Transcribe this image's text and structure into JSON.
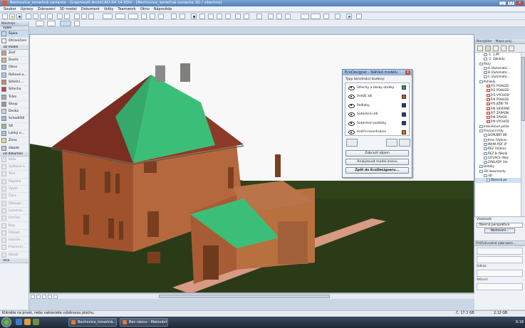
{
  "window": {
    "title": "Bechovice_konečná varianta - Graphisoft ArchiCAD-64 14 EDU - [Bechovice_konečná varianta 3D / všechno]",
    "buttons": [
      "_",
      "□",
      "×"
    ]
  },
  "menu": [
    "Soubor",
    "Úpravy",
    "Zobrazení",
    "3D model",
    "Dokument",
    "Volby",
    "Teamwork",
    "Okno",
    "Nápověda"
  ],
  "toolbox": {
    "title": "Nástroje...",
    "select_section": "Výběr",
    "select_items": [
      "Šipka",
      "Ohraničení"
    ],
    "section_3d": "3D model",
    "items_3d": [
      "Zeď",
      "Dveře",
      "Okno",
      "Rohové o...",
      "Střešní ...",
      "Střecha",
      "Trám",
      "Sloup",
      "Deska",
      "Schodiště",
      "Síť",
      "Lehký o...",
      "Zóna",
      "Objekt"
    ],
    "section_2d": "2D dokumen",
    "items_2d": [
      "Kóta",
      "Výšková k...",
      "Text",
      "Popiska",
      "Výplň",
      "Čára",
      "Oblouk/...",
      "Lomená...",
      "Hrnčka",
      "Bay",
      "Pohled",
      "Interiér...",
      "Pracovní...",
      "Detail"
    ],
    "more": "Více"
  },
  "ecodesigner": {
    "title": "EcoDesigner - Náhled modelu",
    "subtitle": "Typy konstrukcí budovy:",
    "rows": [
      {
        "label": "Střechy a desky otvěky",
        "color": "#27a05a"
      },
      {
        "label": "Vnější zdi",
        "color": "#c05a2a"
      },
      {
        "label": "Podlahy",
        "color": "#1e3a8a"
      },
      {
        "label": "Suterénní zdi",
        "color": "#1e3a8a"
      },
      {
        "label": "Suterénní podlahy",
        "color": "#1e3a8a"
      },
      {
        "label": "Vnitřní konstrukce",
        "color": "#e0701e"
      }
    ],
    "btn_show": "Zobrazit objem",
    "btn_analyze": "Analyzovat model znovu",
    "btn_back": "Zpět do EcoDesigneru..."
  },
  "navigator": {
    "title": "Navigátor - Mapa proj...",
    "items": [
      {
        "label": "-1. 1.PP",
        "red": false
      },
      {
        "label": "-2. Základy",
        "red": false
      },
      {
        "label": "Řezy",
        "red": false
      },
      {
        "label": "A (Automatic...",
        "red": false
      },
      {
        "label": "B (Automatic...",
        "red": false
      },
      {
        "label": "C (Automatic...",
        "red": false
      },
      {
        "label": "Pohledy",
        "red": false
      },
      {
        "label": "P/1 POHLED",
        "red": true
      },
      {
        "label": "P/2 POHLED",
        "red": true
      },
      {
        "label": "P/3 VÝCHOD",
        "red": true
      },
      {
        "label": "P/4 POHLED",
        "red": true
      },
      {
        "label": "P/5 JIŽNÍ TR",
        "red": true
      },
      {
        "label": "P/6 SEVERNÍ",
        "red": true
      },
      {
        "label": "P/7 ZÁPADN",
        "red": true
      },
      {
        "label": "P/8 ZÁVOD",
        "red": true
      },
      {
        "label": "P/9 VÝCHOD",
        "red": true
      },
      {
        "label": "Interiérové pohle",
        "red": false
      },
      {
        "label": "Pracovní listy",
        "red": false
      },
      {
        "label": "DOPLŇKY BR",
        "red": false
      },
      {
        "label": "Krov (Výkres",
        "red": false
      },
      {
        "label": "MAPA PDF (P",
        "red": false
      },
      {
        "label": "ŘEZ (Výkres",
        "red": false
      },
      {
        "label": "ŘEZ B (Nezál",
        "red": false
      },
      {
        "label": "SITUACE (Nez",
        "red": false
      },
      {
        "label": "ZÁKLADY (Ve",
        "red": false
      },
      {
        "label": "Detaily",
        "red": false
      },
      {
        "label": "3D dokumenty",
        "red": false
      },
      {
        "label": "3D",
        "red": false
      },
      {
        "label": "Obecná pe",
        "red": false
      }
    ],
    "props_label": "Vlastnosti",
    "view_name": "Obecná perspektiva",
    "settings_btn": "Nastavení..."
  },
  "infobox": {
    "title": "Průčelivodné zobrazen...",
    "label1": "Odkaz:",
    "label2": "Aktivní:"
  },
  "status": {
    "text": "Klikněte na prvek, nebo nakreslete výběrovou plochu.",
    "disk1": "C: 17.3 GB",
    "disk2": "2.12 GB"
  },
  "taskbar": {
    "tasks": [
      "Bechovice_konečná...",
      "Bez názvu - Malování"
    ],
    "clock": "9:18"
  },
  "colors": {
    "roof": "#8e3a2a",
    "wall": "#b0643c",
    "green": "#3bbf78",
    "ground": "#2b3b18"
  }
}
